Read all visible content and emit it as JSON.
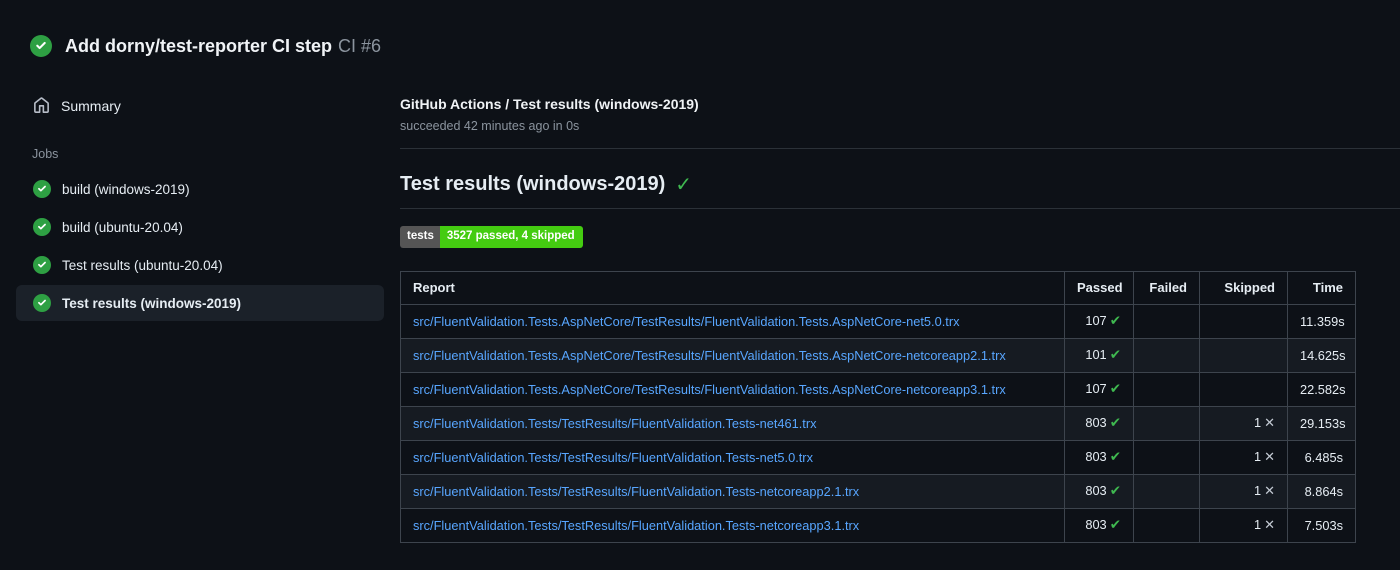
{
  "header": {
    "run_title": "Add dorny/test-reporter CI step",
    "run_number": "CI #6",
    "status": "success"
  },
  "sidebar": {
    "summary_label": "Summary",
    "jobs_label": "Jobs",
    "jobs": [
      {
        "label": "build (windows-2019)",
        "status": "success",
        "selected": false
      },
      {
        "label": "build (ubuntu-20.04)",
        "status": "success",
        "selected": false
      },
      {
        "label": "Test results (ubuntu-20.04)",
        "status": "success",
        "selected": false
      },
      {
        "label": "Test results (windows-2019)",
        "status": "success",
        "selected": true
      }
    ]
  },
  "main": {
    "job_title": "GitHub Actions / Test results (windows-2019)",
    "job_status": "succeeded 42 minutes ago in 0s",
    "section_title": "Test results (windows-2019)",
    "section_check": "✓",
    "badge": {
      "label": "tests",
      "value": "3527 passed, 4 skipped"
    },
    "table": {
      "columns": [
        "Report",
        "Passed",
        "Failed",
        "Skipped",
        "Time"
      ],
      "pass_icon": "✔",
      "skip_icon": "✕",
      "rows": [
        {
          "report": "src/FluentValidation.Tests.AspNetCore/TestResults/FluentValidation.Tests.AspNetCore-net5.0.trx",
          "passed": "107",
          "failed": "",
          "skipped": "",
          "time": "11.359s"
        },
        {
          "report": "src/FluentValidation.Tests.AspNetCore/TestResults/FluentValidation.Tests.AspNetCore-netcoreapp2.1.trx",
          "passed": "101",
          "failed": "",
          "skipped": "",
          "time": "14.625s"
        },
        {
          "report": "src/FluentValidation.Tests.AspNetCore/TestResults/FluentValidation.Tests.AspNetCore-netcoreapp3.1.trx",
          "passed": "107",
          "failed": "",
          "skipped": "",
          "time": "22.582s"
        },
        {
          "report": "src/FluentValidation.Tests/TestResults/FluentValidation.Tests-net461.trx",
          "passed": "803",
          "failed": "",
          "skipped": "1",
          "time": "29.153s"
        },
        {
          "report": "src/FluentValidation.Tests/TestResults/FluentValidation.Tests-net5.0.trx",
          "passed": "803",
          "failed": "",
          "skipped": "1",
          "time": "6.485s"
        },
        {
          "report": "src/FluentValidation.Tests/TestResults/FluentValidation.Tests-netcoreapp2.1.trx",
          "passed": "803",
          "failed": "",
          "skipped": "1",
          "time": "8.864s"
        },
        {
          "report": "src/FluentValidation.Tests/TestResults/FluentValidation.Tests-netcoreapp3.1.trx",
          "passed": "803",
          "failed": "",
          "skipped": "1",
          "time": "7.503s"
        }
      ]
    }
  },
  "colors": {
    "background": "#0d1117",
    "success_green": "#2ea043",
    "check_green": "#3fb950",
    "link_blue": "#58a6ff",
    "badge_label_bg": "#555555",
    "badge_value_bg": "#44cc11",
    "muted_text": "#8b949e",
    "row_stripe": "#161b22",
    "table_border": "#3d444d",
    "selected_item_bg": "#1b2129"
  }
}
